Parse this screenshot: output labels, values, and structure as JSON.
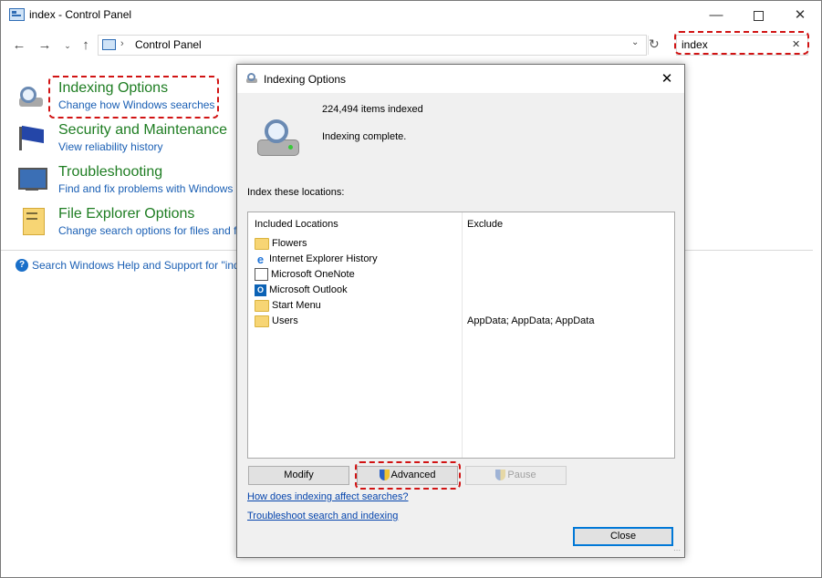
{
  "window": {
    "title": "index - Control Panel",
    "minimize_icon": "minimize-icon",
    "maximize_icon": "maximize-icon",
    "close_icon": "close-icon"
  },
  "nav": {
    "breadcrumb_root": "Control Panel",
    "search_value": "index",
    "search_clear": "✕"
  },
  "results": [
    {
      "title": "Indexing Options",
      "link": "Change how Windows searches"
    },
    {
      "title": "Security and Maintenance",
      "link": "View reliability history"
    },
    {
      "title": "Troubleshooting",
      "link": "Find and fix problems with Windows"
    },
    {
      "title": "File Explorer Options",
      "link": "Change search options for files and fo"
    }
  ],
  "help_link": "Search Windows Help and Support for \"ind",
  "dialog": {
    "title": "Indexing Options",
    "items_indexed": "224,494 items indexed",
    "status": "Indexing complete.",
    "locations_label": "Index these locations:",
    "col_included": "Included Locations",
    "col_exclude": "Exclude",
    "locations": [
      {
        "name": "Flowers",
        "icon": "folder-icon",
        "exclude": ""
      },
      {
        "name": "Internet Explorer History",
        "icon": "ie-icon",
        "exclude": ""
      },
      {
        "name": "Microsoft OneNote",
        "icon": "onenote-icon",
        "exclude": ""
      },
      {
        "name": "Microsoft Outlook",
        "icon": "outlook-icon",
        "exclude": ""
      },
      {
        "name": "Start Menu",
        "icon": "folder-icon",
        "exclude": ""
      },
      {
        "name": "Users",
        "icon": "folder-icon",
        "exclude": "AppData; AppData; AppData"
      }
    ],
    "modify_label": "Modify",
    "advanced_label": "Advanced",
    "pause_label": "Pause",
    "link_affect": "How does indexing affect searches?",
    "link_troubleshoot": "Troubleshoot search and indexing",
    "close_label": "Close"
  },
  "colors": {
    "accent_green": "#1e7d22",
    "link_blue": "#1a5fb4",
    "highlight_red": "#d11313"
  }
}
